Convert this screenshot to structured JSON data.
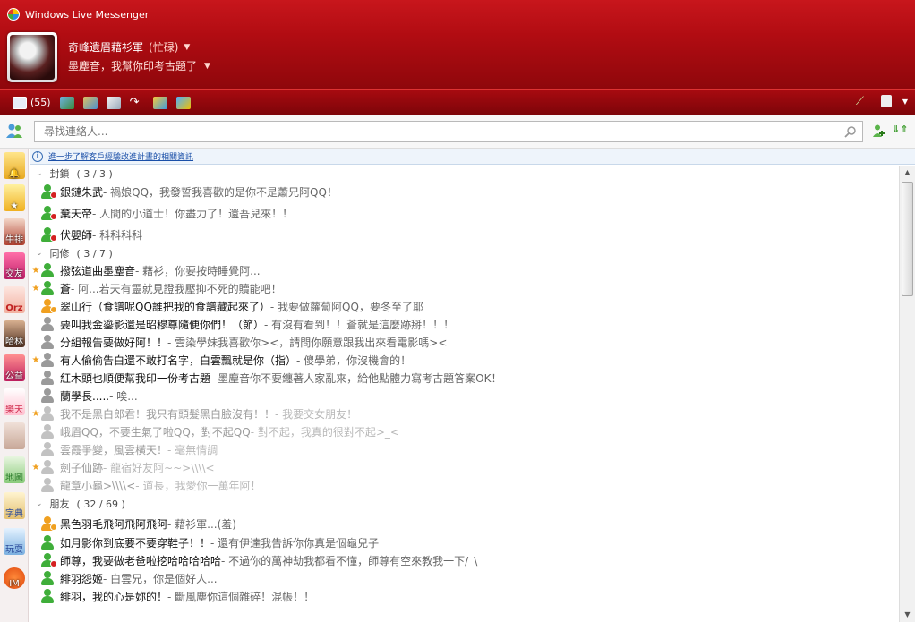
{
  "window": {
    "title": "Windows Live Messenger"
  },
  "user": {
    "name": "奇峰遺眉藉衫軍",
    "status": "(忙碌)",
    "personal_message": "墨塵音，我幫你印考古題了"
  },
  "toolbar": {
    "mail_count": "(55)"
  },
  "search": {
    "placeholder": "尋找連絡人..."
  },
  "infobar": {
    "text": "進一步了解客戶經驗改進計畫的相關資訊"
  },
  "sidebar": {
    "items": [
      {
        "icon": "bell-icon",
        "label": ""
      },
      {
        "icon": "star-icon",
        "label": ""
      },
      {
        "icon": "cow-icon",
        "label": "牛排"
      },
      {
        "icon": "heart-icon",
        "label": "交友"
      },
      {
        "icon": "orz-icon",
        "label": "Orz"
      },
      {
        "icon": "person-icon",
        "label": "哈林"
      },
      {
        "icon": "sticker-icon",
        "label": "公益"
      },
      {
        "icon": "kitty-icon",
        "label": "樂天"
      },
      {
        "icon": "face-icon",
        "label": ""
      },
      {
        "icon": "map-icon",
        "label": "地圖"
      },
      {
        "icon": "book-icon",
        "label": "字典"
      },
      {
        "icon": "game-icon",
        "label": "玩耍"
      },
      {
        "icon": "im-icon",
        "label": "IM"
      }
    ]
  },
  "groups": [
    {
      "label": "封鎖",
      "count": "( 3 / 3 )"
    },
    {
      "label": "同修",
      "count": "( 3 / 7 )"
    },
    {
      "label": "朋友",
      "count": "( 32 / 69 )"
    }
  ],
  "contacts": [
    {
      "name": "銀鏈朱武",
      "msg": " - 禍娘QQ，我發誓我喜歡的是你不是蕭兄阿QQ！",
      "presence": "blocked",
      "star": false,
      "dim": false
    },
    {
      "name": "棄天帝",
      "msg": " - 人間的小道士！你盡力了！還吾兒來！！",
      "presence": "blocked",
      "star": false,
      "dim": false
    },
    {
      "name": "伏嬰師",
      "msg": " - 科科科科",
      "presence": "blocked",
      "star": false,
      "dim": false
    },
    {
      "name": "撥弦道曲墨塵音",
      "msg": " - 藉衫，你要按時睡覺阿...",
      "presence": "online",
      "star": true,
      "dim": false
    },
    {
      "name": "蒼",
      "msg": " - 阿...若天有靈就見證我壓抑不死的贖能吧！",
      "presence": "online",
      "star": true,
      "dim": false
    },
    {
      "name": "翠山行（食譜呢QQ誰把我的食譜藏起來了）",
      "msg": " - 我要做蘿蔔阿QQ，要冬至了耶",
      "presence": "away",
      "star": false,
      "dim": false
    },
    {
      "name": "要叫我金鎏影還是昭穆尊隨便你們！（節）",
      "msg": " - 有沒有看到！！蒼就是這麼跡掰！！！",
      "presence": "offline",
      "star": false,
      "dim": false
    },
    {
      "name": "分組報告要做好阿！！",
      "msg": " - 雲染學妹我喜歡你><，請問你願意跟我出來看電影嗎><",
      "presence": "offline",
      "star": false,
      "dim": false
    },
    {
      "name": "有人偷偷告白還不敢打名字，白雲飄就是你（指）",
      "msg": " - 傻學弟，你沒機會的！",
      "presence": "offline",
      "star": true,
      "dim": false
    },
    {
      "name": "紅木頭也順便幫我印一份考古題",
      "msg": " - 墨塵音你不要纏著人家亂來，給他點體力寫考古題答案OK！",
      "presence": "offline",
      "star": false,
      "dim": false
    },
    {
      "name": "蘭學長.....",
      "msg": " - 唉...",
      "presence": "offline",
      "star": false,
      "dim": false
    },
    {
      "name": "我不是黑白郎君！我只有頭髮黑白臉沒有！！",
      "msg": " - 我要交女朋友！",
      "presence": "offline",
      "star": true,
      "dim": true
    },
    {
      "name": "峨眉QQ，不要生氣了啦QQ，對不起QQ",
      "msg": " - 對不起，我真的很對不起>_<",
      "presence": "offline",
      "star": false,
      "dim": true
    },
    {
      "name": "雲霞爭變，風雲橫天！",
      "msg": " - 毫無情調",
      "presence": "offline",
      "star": false,
      "dim": true
    },
    {
      "name": "劍子仙跡",
      "msg": " - 龍宿好友阿~~>\\\\\\\\<",
      "presence": "offline",
      "star": true,
      "dim": true
    },
    {
      "name": "龍章小龜>\\\\\\\\<",
      "msg": " - 道長，我愛你一萬年阿！",
      "presence": "offline",
      "star": false,
      "dim": true
    },
    {
      "name": "黑色羽毛飛阿飛阿飛阿",
      "msg": " - 藉衫軍...(羞)",
      "presence": "away",
      "star": false,
      "dim": false
    },
    {
      "name": "如月影你到底要不要穿鞋子！！",
      "msg": " - 還有伊達我告訴你你真是個龜兒子",
      "presence": "online",
      "star": false,
      "dim": false
    },
    {
      "name": "師尊，我要做老爸啦挖哈哈哈哈哈",
      "msg": " - 不過你的萬神劫我都看不懂，師尊有空來教我一下/_\\",
      "presence": "blocked",
      "star": false,
      "dim": false
    },
    {
      "name": "緋羽怨姬",
      "msg": " - 白雲兄，你是個好人...",
      "presence": "online",
      "star": false,
      "dim": false
    },
    {
      "name": "緋羽，我的心是妳的！",
      "msg": " - 斷風塵你這個雜碎！混帳！！",
      "presence": "online",
      "star": false,
      "dim": false
    }
  ],
  "colors": {
    "header_red": "#b10c12",
    "online": "#3fae3a",
    "away": "#f0a020",
    "busy": "#d42020",
    "offline": "#9a9a9a",
    "link": "#1a4fa8"
  }
}
